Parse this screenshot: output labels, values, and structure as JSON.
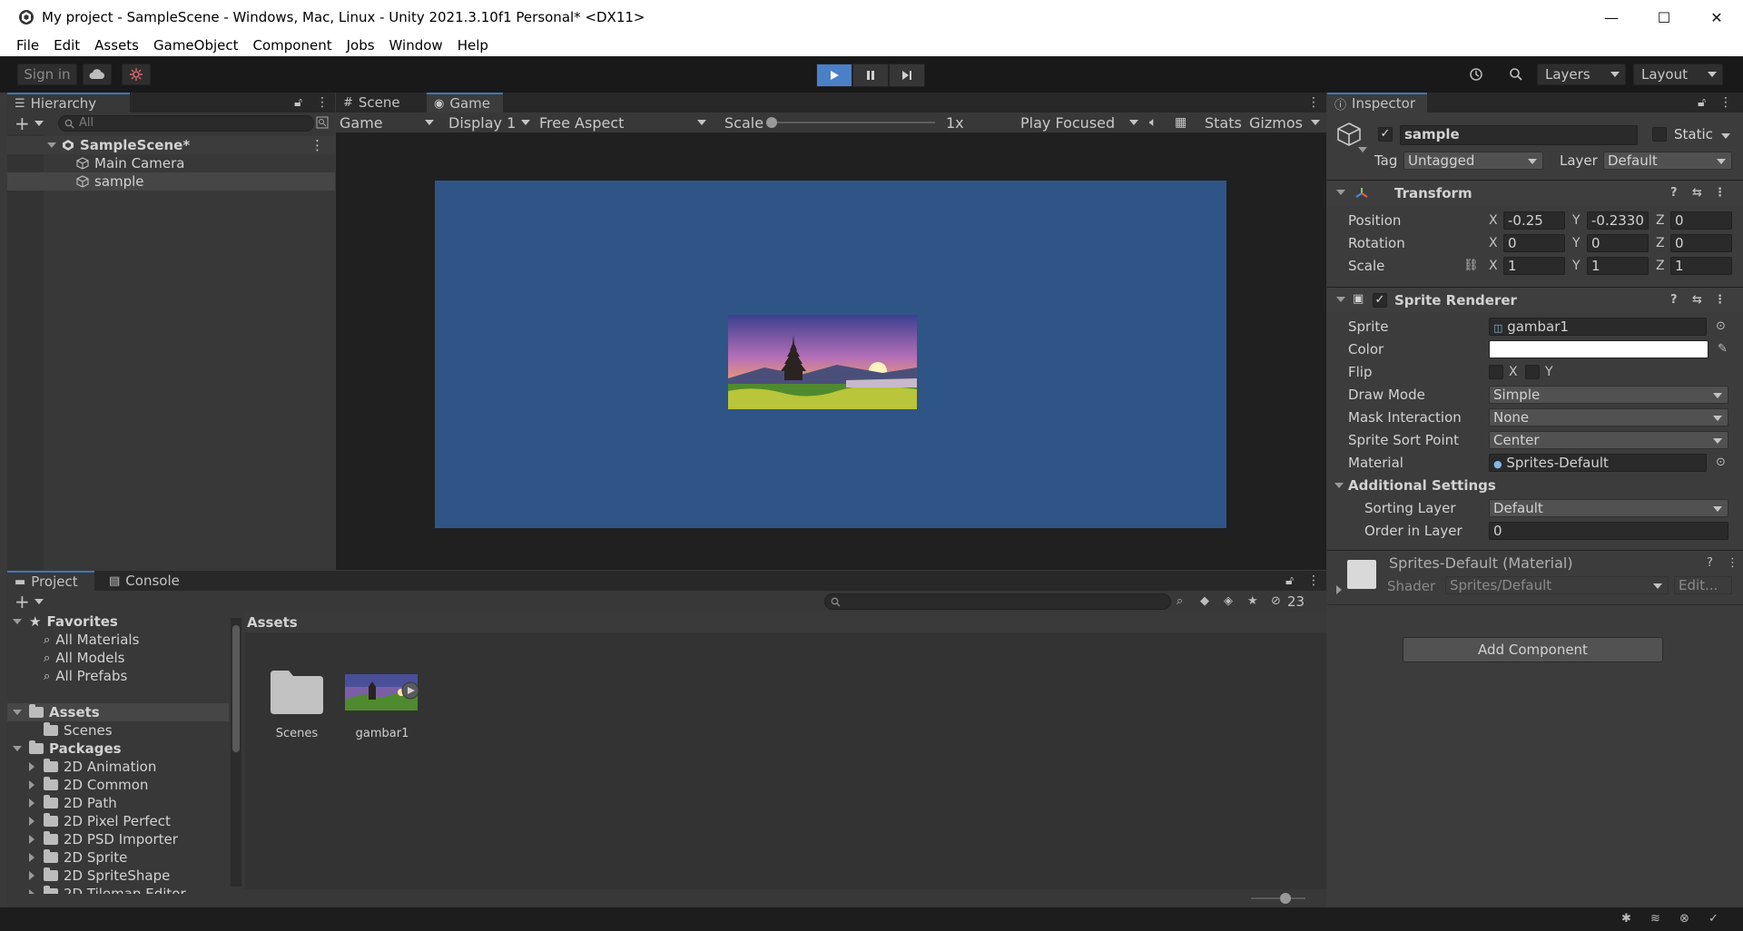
{
  "window": {
    "title": "My project - SampleScene - Windows, Mac, Linux - Unity 2021.3.10f1 Personal* <DX11>"
  },
  "menu": [
    "File",
    "Edit",
    "Assets",
    "GameObject",
    "Component",
    "Jobs",
    "Window",
    "Help"
  ],
  "toolbar": {
    "sign_in": "Sign in",
    "layers": "Layers",
    "layout": "Layout",
    "play_active": true
  },
  "hierarchy": {
    "tab": "Hierarchy",
    "search_placeholder": "All",
    "scene": "SampleScene*",
    "items": [
      "Main Camera",
      "sample"
    ]
  },
  "game": {
    "tabs": [
      "Scene",
      "Game"
    ],
    "mode": "Game",
    "display": "Display 1",
    "aspect": "Free Aspect",
    "scale_label": "Scale",
    "scale_value": "1x",
    "play_mode": "Play Focused",
    "stats": "Stats",
    "gizmos": "Gizmos",
    "canvas_color": "#2f5586"
  },
  "inspector": {
    "tab": "Inspector",
    "object_name": "sample",
    "static_label": "Static",
    "tag_label": "Tag",
    "tag_value": "Untagged",
    "layer_label": "Layer",
    "layer_value": "Default",
    "transform": {
      "title": "Transform",
      "position_label": "Position",
      "rotation_label": "Rotation",
      "scale_label": "Scale",
      "position": {
        "x": "-0.25",
        "y": "-0.2330",
        "z": "0"
      },
      "rotation": {
        "x": "0",
        "y": "0",
        "z": "0"
      },
      "scale": {
        "x": "1",
        "y": "1",
        "z": "1"
      }
    },
    "sprite_renderer": {
      "title": "Sprite Renderer",
      "sprite_label": "Sprite",
      "sprite_value": "gambar1",
      "color_label": "Color",
      "flip_label": "Flip",
      "flip_x": "X",
      "flip_y": "Y",
      "draw_mode_label": "Draw Mode",
      "draw_mode_value": "Simple",
      "mask_label": "Mask Interaction",
      "mask_value": "None",
      "sort_point_label": "Sprite Sort Point",
      "sort_point_value": "Center",
      "material_label": "Material",
      "material_value": "Sprites-Default",
      "additional_label": "Additional Settings",
      "sorting_layer_label": "Sorting Layer",
      "sorting_layer_value": "Default",
      "order_label": "Order in Layer",
      "order_value": "0"
    },
    "material": {
      "title": "Sprites-Default (Material)",
      "shader_label": "Shader",
      "shader_value": "Sprites/Default",
      "edit_label": "Edit..."
    },
    "add_component": "Add Component"
  },
  "project": {
    "tabs": [
      "Project",
      "Console"
    ],
    "hidden_count": "23",
    "favorites_label": "Favorites",
    "favorites": [
      "All Materials",
      "All Models",
      "All Prefabs"
    ],
    "assets_label": "Assets",
    "assets_children": [
      "Scenes"
    ],
    "packages_label": "Packages",
    "packages": [
      "2D Animation",
      "2D Common",
      "2D Path",
      "2D Pixel Perfect",
      "2D PSD Importer",
      "2D Sprite",
      "2D SpriteShape",
      "2D Tilemap Editor"
    ],
    "breadcrumb": "Assets",
    "asset_items": [
      "Scenes",
      "gambar1"
    ]
  }
}
